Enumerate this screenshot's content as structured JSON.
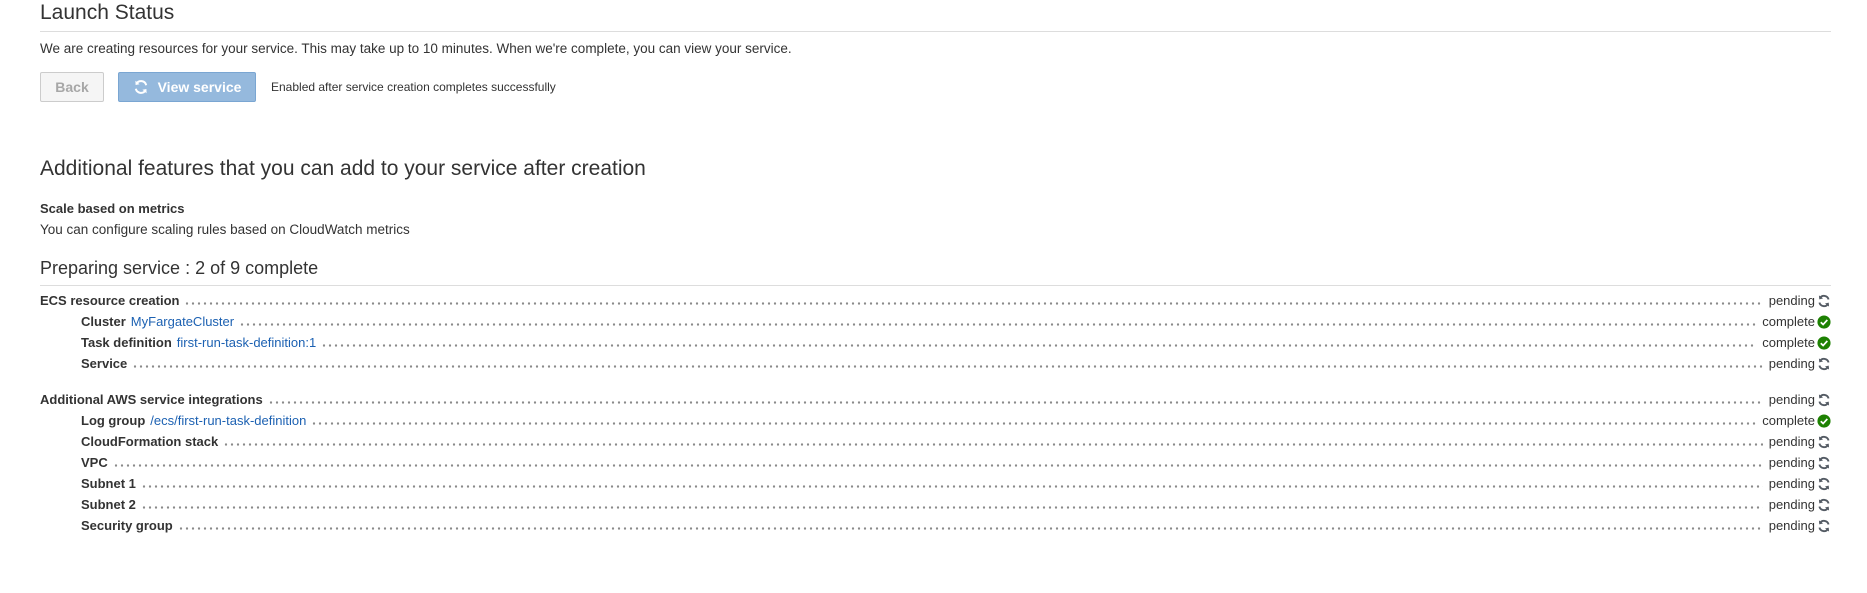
{
  "header": {
    "title": "Launch Status",
    "intro": "We are creating resources for your service. This may take up to 10 minutes. When we're complete, you can view your service."
  },
  "buttons": {
    "back_label": "Back",
    "view_label": "View service",
    "note": "Enabled after service creation completes successfully"
  },
  "additional": {
    "title": "Additional features that you can add to your service after creation",
    "feature_title": "Scale based on metrics",
    "feature_desc": "You can configure scaling rules based on CloudWatch metrics"
  },
  "progress": {
    "title": "Preparing service : 2 of 9 complete",
    "groups": [
      {
        "label": "ECS resource creation",
        "status": "pending",
        "items": [
          {
            "label": "Cluster",
            "link": "MyFargateCluster",
            "status": "complete"
          },
          {
            "label": "Task definition",
            "link": "first-run-task-definition:1",
            "status": "complete"
          },
          {
            "label": "Service",
            "link": "",
            "status": "pending"
          }
        ]
      },
      {
        "label": "Additional AWS service integrations",
        "status": "pending",
        "items": [
          {
            "label": "Log group",
            "link": "/ecs/first-run-task-definition",
            "status": "complete"
          },
          {
            "label": "CloudFormation stack",
            "link": "",
            "status": "pending"
          },
          {
            "label": "VPC",
            "link": "",
            "status": "pending"
          },
          {
            "label": "Subnet 1",
            "link": "",
            "status": "pending"
          },
          {
            "label": "Subnet 2",
            "link": "",
            "status": "pending"
          },
          {
            "label": "Security group",
            "link": "",
            "status": "pending"
          }
        ]
      }
    ]
  },
  "icons": {
    "pending": "refresh-icon",
    "complete": "check-circle-icon",
    "view_button": "refresh-icon"
  },
  "colors": {
    "link": "#1c61b2",
    "complete": "#1d8102",
    "pending_icon": "#545b64",
    "view_button": "#95b9dd"
  }
}
